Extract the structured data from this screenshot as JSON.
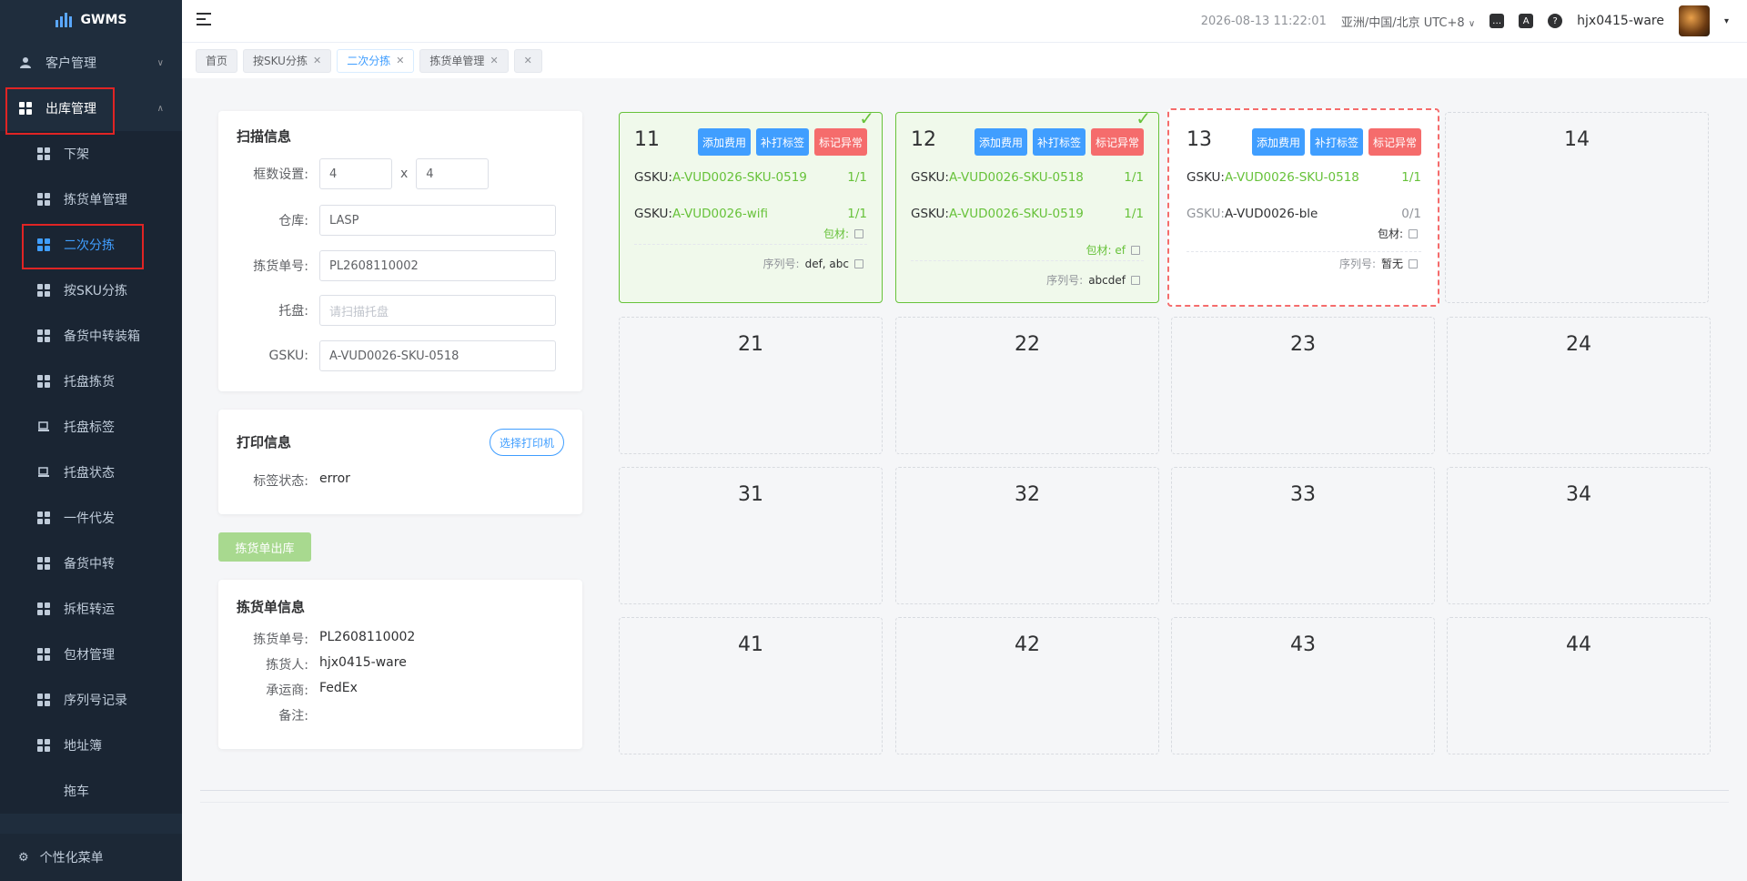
{
  "app": {
    "name": "GWMS"
  },
  "sidebar": {
    "customer": "客户管理",
    "outbound": "出库管理",
    "items": [
      "下架",
      "拣货单管理",
      "二次分拣",
      "按SKU分拣",
      "备货中转装箱",
      "托盘拣货",
      "托盘标签",
      "托盘状态",
      "一件代发",
      "备货中转",
      "拆柜转运",
      "包材管理",
      "序列号记录",
      "地址簿",
      "拖车"
    ],
    "footer": "个性化菜单"
  },
  "header": {
    "datetime": "2026-08-13 11:22:01",
    "timezone": "亚洲/中国/北京 UTC+8",
    "user": "hjx0415-ware"
  },
  "tabs": [
    "首页",
    "按SKU分拣",
    "二次分拣",
    "拣货单管理",
    ""
  ],
  "scan": {
    "title": "扫描信息",
    "frame_label": "框数设置:",
    "frame_rows": "4",
    "frame_x": "x",
    "frame_cols": "4",
    "warehouse_label": "仓库:",
    "warehouse": "LASP",
    "picklist_label": "拣货单号:",
    "picklist": "PL2608110002",
    "pallet_label": "托盘:",
    "pallet_placeholder": "请扫描托盘",
    "gsku_label": "GSKU:",
    "gsku": "A-VUD0026-SKU-0518"
  },
  "print": {
    "title": "打印信息",
    "printer_button": "选择打印机",
    "status_label": "标签状态:",
    "status": "error"
  },
  "outbound_button": "拣货单出库",
  "picklist_info": {
    "title": "拣货单信息",
    "no_label": "拣货单号:",
    "no": "PL2608110002",
    "picker_label": "拣货人:",
    "picker": "hjx0415-ware",
    "carrier_label": "承运商:",
    "carrier": "FedEx",
    "remark_label": "备注:",
    "remark": ""
  },
  "actions": {
    "add_fee": "添加费用",
    "reprint": "补打标签",
    "mark_error": "标记异常"
  },
  "slots": {
    "s11": {
      "num": "11",
      "g1_label": "GSKU:",
      "g1_sku": "A-VUD0026-SKU-0519",
      "g1_qty": "1/1",
      "g2_label": "GSKU:",
      "g2_sku": "A-VUD0026-wifi",
      "g2_qty": "1/1",
      "pack": "包材:",
      "serial_label": "序列号:",
      "serial": "def, abc"
    },
    "s12": {
      "num": "12",
      "g1_label": "GSKU:",
      "g1_sku": "A-VUD0026-SKU-0518",
      "g1_qty": "1/1",
      "g2_label": "GSKU:",
      "g2_sku": "A-VUD0026-SKU-0519",
      "g2_qty": "1/1",
      "pack": "包材: ef",
      "serial_label": "序列号:",
      "serial": "abcdef"
    },
    "s13": {
      "num": "13",
      "g1_label": "GSKU:",
      "g1_sku": "A-VUD0026-SKU-0518",
      "g1_qty": "1/1",
      "g2_label": "GSKU:",
      "g2_sku": "A-VUD0026-ble",
      "g2_qty": "0/1",
      "pack": "包材:",
      "serial_label": "序列号:",
      "serial": "暂无"
    },
    "empty": [
      "14",
      "21",
      "22",
      "23",
      "24",
      "31",
      "32",
      "33",
      "34",
      "41",
      "42",
      "43",
      "44"
    ]
  },
  "colors": {
    "primary": "#409eff",
    "success": "#67c23a",
    "danger": "#f56c6c",
    "sidebar": "#1f2d3d"
  }
}
